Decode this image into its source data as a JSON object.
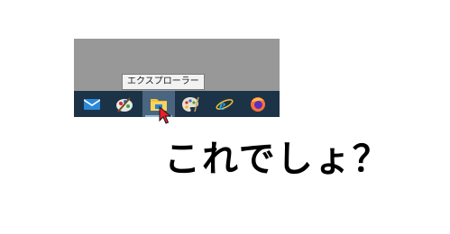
{
  "tooltip": {
    "text": "エクスプローラー"
  },
  "taskbar": {
    "items": [
      {
        "icon": "mail-icon",
        "active": false
      },
      {
        "icon": "paint-icon",
        "active": false
      },
      {
        "icon": "file-explorer-icon",
        "active": true
      },
      {
        "icon": "palette-icon",
        "active": false
      },
      {
        "icon": "internet-explorer-icon",
        "active": false
      },
      {
        "icon": "firefox-icon",
        "active": false
      }
    ]
  },
  "caption": {
    "text": "これでしょ？"
  },
  "colors": {
    "taskbar": "#1c3347",
    "desktop": "#989898",
    "active_button": "#4a6580"
  }
}
